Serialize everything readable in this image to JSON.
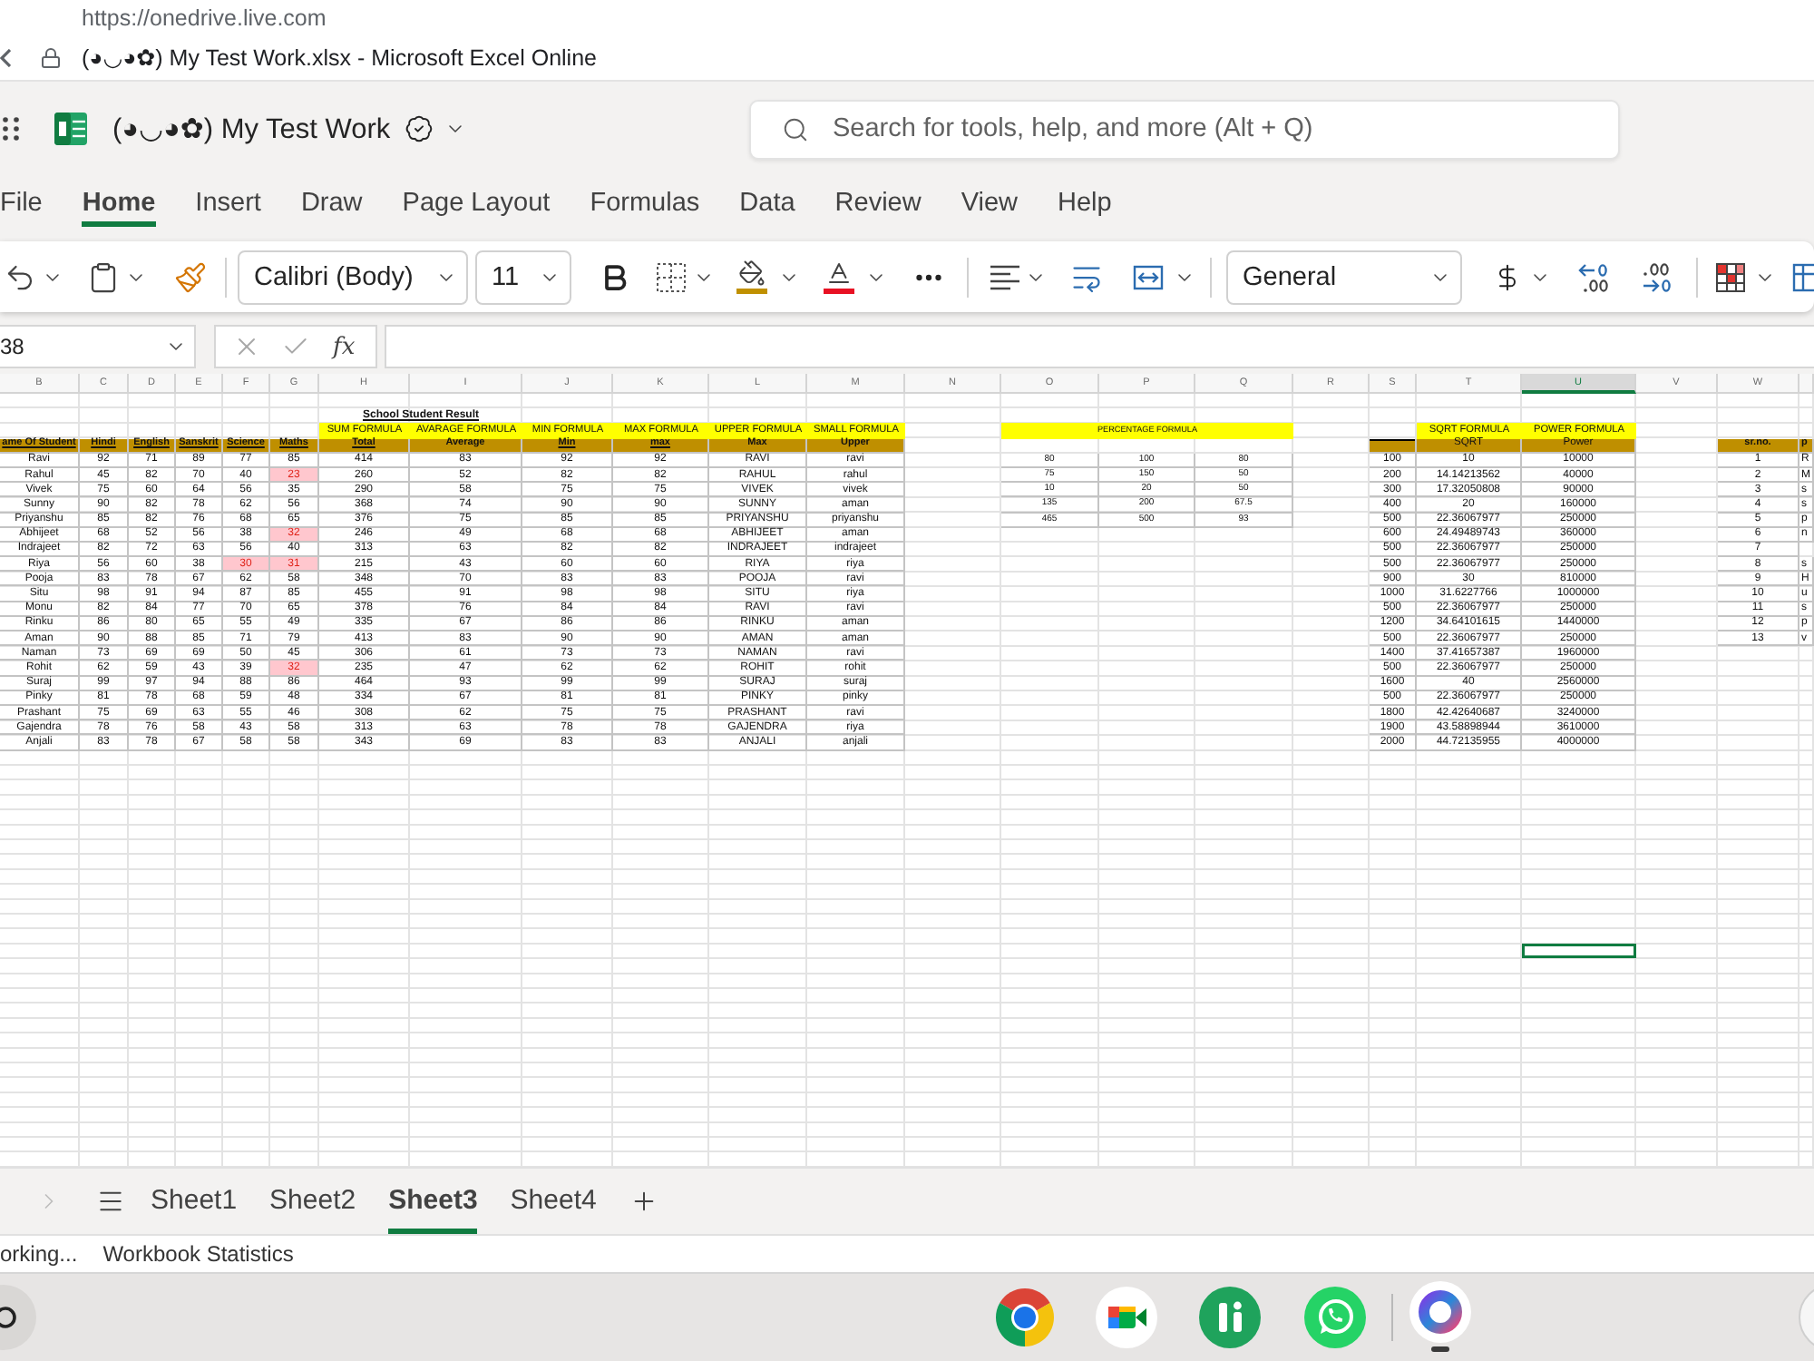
{
  "browser": {
    "url": "https://onedrive.live.com",
    "title": "(◕◡◕✿) My Test Work.xlsx - Microsoft Excel Online"
  },
  "app_bar": {
    "document_title": "(◕◡◕✿) My Test Work",
    "search": {
      "placeholder": "Search for tools, help, and more (Alt + Q)"
    }
  },
  "ribbon_tabs": [
    {
      "label": "File",
      "selected": false
    },
    {
      "label": "Home",
      "selected": true
    },
    {
      "label": "Insert",
      "selected": false
    },
    {
      "label": "Draw",
      "selected": false
    },
    {
      "label": "Page Layout",
      "selected": false
    },
    {
      "label": "Formulas",
      "selected": false
    },
    {
      "label": "Data",
      "selected": false
    },
    {
      "label": "Review",
      "selected": false
    },
    {
      "label": "View",
      "selected": false
    },
    {
      "label": "Help",
      "selected": false
    }
  ],
  "toolbar": {
    "font": "Calibri (Body)",
    "font_size": "11",
    "number_format": "General"
  },
  "formula_bar": {
    "name_box": "38",
    "function_button": "fx"
  },
  "sheet": {
    "columns": [
      {
        "letter": "B",
        "selected": false
      },
      {
        "letter": "C",
        "selected": false
      },
      {
        "letter": "D",
        "selected": false
      },
      {
        "letter": "E",
        "selected": false
      },
      {
        "letter": "F",
        "selected": false
      },
      {
        "letter": "G",
        "selected": false
      },
      {
        "letter": "H",
        "selected": false
      },
      {
        "letter": "I",
        "selected": false
      },
      {
        "letter": "J",
        "selected": false
      },
      {
        "letter": "K",
        "selected": false
      },
      {
        "letter": "L",
        "selected": false
      },
      {
        "letter": "M",
        "selected": false
      },
      {
        "letter": "N",
        "selected": false
      },
      {
        "letter": "O",
        "selected": false
      },
      {
        "letter": "P",
        "selected": false
      },
      {
        "letter": "Q",
        "selected": false
      },
      {
        "letter": "R",
        "selected": false
      },
      {
        "letter": "S",
        "selected": false
      },
      {
        "letter": "T",
        "selected": false
      },
      {
        "letter": "U",
        "selected": true
      },
      {
        "letter": "V",
        "selected": false
      },
      {
        "letter": "W",
        "selected": false
      }
    ],
    "title": "School Student Result",
    "formula_labels": [
      "SUM FORMULA",
      "AVARAGE FORMULA",
      "MIN FORMULA",
      "MAX FORMULA",
      "UPPER FORMULA",
      "SMALL FORMULA"
    ],
    "headers": [
      {
        "text": "ame Of Student",
        "underlined": true
      },
      {
        "text": "Hindi",
        "underlined": true
      },
      {
        "text": "English",
        "underlined": true
      },
      {
        "text": "Sanskrit",
        "underlined": true
      },
      {
        "text": "Science",
        "underlined": true
      },
      {
        "text": "Maths",
        "underlined": true
      },
      {
        "text": "Total",
        "underlined": true
      },
      {
        "text": "Average",
        "underlined": false
      },
      {
        "text": "Min",
        "underlined": true
      },
      {
        "text": "max",
        "underlined": true
      },
      {
        "text": "Max",
        "underlined": false
      },
      {
        "text": "Upper",
        "underlined": false
      }
    ],
    "students": [
      {
        "name": "Ravi",
        "marks": [
          {
            "value": "92",
            "flagged": false
          },
          {
            "value": "71",
            "flagged": false
          },
          {
            "value": "89",
            "flagged": false
          },
          {
            "value": "77",
            "flagged": false
          },
          {
            "value": "85",
            "flagged": false
          }
        ],
        "results": [
          "414",
          "83",
          "92",
          "92",
          "RAVI",
          "ravi"
        ]
      },
      {
        "name": "Rahul",
        "marks": [
          {
            "value": "45",
            "flagged": false
          },
          {
            "value": "82",
            "flagged": false
          },
          {
            "value": "70",
            "flagged": false
          },
          {
            "value": "40",
            "flagged": false
          },
          {
            "value": "23",
            "flagged": true
          }
        ],
        "results": [
          "260",
          "52",
          "82",
          "82",
          "RAHUL",
          "rahul"
        ]
      },
      {
        "name": "Vivek",
        "marks": [
          {
            "value": "75",
            "flagged": false
          },
          {
            "value": "60",
            "flagged": false
          },
          {
            "value": "64",
            "flagged": false
          },
          {
            "value": "56",
            "flagged": false
          },
          {
            "value": "35",
            "flagged": false
          }
        ],
        "results": [
          "290",
          "58",
          "75",
          "75",
          "VIVEK",
          "vivek"
        ]
      },
      {
        "name": "Sunny",
        "marks": [
          {
            "value": "90",
            "flagged": false
          },
          {
            "value": "82",
            "flagged": false
          },
          {
            "value": "78",
            "flagged": false
          },
          {
            "value": "62",
            "flagged": false
          },
          {
            "value": "56",
            "flagged": false
          }
        ],
        "results": [
          "368",
          "74",
          "90",
          "90",
          "SUNNY",
          "aman"
        ]
      },
      {
        "name": "Priyanshu",
        "marks": [
          {
            "value": "85",
            "flagged": false
          },
          {
            "value": "82",
            "flagged": false
          },
          {
            "value": "76",
            "flagged": false
          },
          {
            "value": "68",
            "flagged": false
          },
          {
            "value": "65",
            "flagged": false
          }
        ],
        "results": [
          "376",
          "75",
          "85",
          "85",
          "PRIYANSHU",
          "priyanshu"
        ]
      },
      {
        "name": "Abhijeet",
        "marks": [
          {
            "value": "68",
            "flagged": false
          },
          {
            "value": "52",
            "flagged": false
          },
          {
            "value": "56",
            "flagged": false
          },
          {
            "value": "38",
            "flagged": false
          },
          {
            "value": "32",
            "flagged": true
          }
        ],
        "results": [
          "246",
          "49",
          "68",
          "68",
          "ABHIJEET",
          "aman"
        ]
      },
      {
        "name": "Indrajeet",
        "marks": [
          {
            "value": "82",
            "flagged": false
          },
          {
            "value": "72",
            "flagged": false
          },
          {
            "value": "63",
            "flagged": false
          },
          {
            "value": "56",
            "flagged": false
          },
          {
            "value": "40",
            "flagged": false
          }
        ],
        "results": [
          "313",
          "63",
          "82",
          "82",
          "INDRAJEET",
          "indrajeet"
        ]
      },
      {
        "name": "Riya",
        "marks": [
          {
            "value": "56",
            "flagged": false
          },
          {
            "value": "60",
            "flagged": false
          },
          {
            "value": "38",
            "flagged": false
          },
          {
            "value": "30",
            "flagged": true
          },
          {
            "value": "31",
            "flagged": true
          }
        ],
        "results": [
          "215",
          "43",
          "60",
          "60",
          "RIYA",
          "riya"
        ]
      },
      {
        "name": "Pooja",
        "marks": [
          {
            "value": "83",
            "flagged": false
          },
          {
            "value": "78",
            "flagged": false
          },
          {
            "value": "67",
            "flagged": false
          },
          {
            "value": "62",
            "flagged": false
          },
          {
            "value": "58",
            "flagged": false
          }
        ],
        "results": [
          "348",
          "70",
          "83",
          "83",
          "POOJA",
          "ravi"
        ]
      },
      {
        "name": "Situ",
        "marks": [
          {
            "value": "98",
            "flagged": false
          },
          {
            "value": "91",
            "flagged": false
          },
          {
            "value": "94",
            "flagged": false
          },
          {
            "value": "87",
            "flagged": false
          },
          {
            "value": "85",
            "flagged": false
          }
        ],
        "results": [
          "455",
          "91",
          "98",
          "98",
          "SITU",
          "riya"
        ]
      },
      {
        "name": "Monu",
        "marks": [
          {
            "value": "82",
            "flagged": false
          },
          {
            "value": "84",
            "flagged": false
          },
          {
            "value": "77",
            "flagged": false
          },
          {
            "value": "70",
            "flagged": false
          },
          {
            "value": "65",
            "flagged": false
          }
        ],
        "results": [
          "378",
          "76",
          "84",
          "84",
          "RAVI",
          "ravi"
        ]
      },
      {
        "name": "Rinku",
        "marks": [
          {
            "value": "86",
            "flagged": false
          },
          {
            "value": "80",
            "flagged": false
          },
          {
            "value": "65",
            "flagged": false
          },
          {
            "value": "55",
            "flagged": false
          },
          {
            "value": "49",
            "flagged": false
          }
        ],
        "results": [
          "335",
          "67",
          "86",
          "86",
          "RINKU",
          "aman"
        ]
      },
      {
        "name": "Aman",
        "marks": [
          {
            "value": "90",
            "flagged": false
          },
          {
            "value": "88",
            "flagged": false
          },
          {
            "value": "85",
            "flagged": false
          },
          {
            "value": "71",
            "flagged": false
          },
          {
            "value": "79",
            "flagged": false
          }
        ],
        "results": [
          "413",
          "83",
          "90",
          "90",
          "AMAN",
          "aman"
        ]
      },
      {
        "name": "Naman",
        "marks": [
          {
            "value": "73",
            "flagged": false
          },
          {
            "value": "69",
            "flagged": false
          },
          {
            "value": "69",
            "flagged": false
          },
          {
            "value": "50",
            "flagged": false
          },
          {
            "value": "45",
            "flagged": false
          }
        ],
        "results": [
          "306",
          "61",
          "73",
          "73",
          "NAMAN",
          "ravi"
        ]
      },
      {
        "name": "Rohit",
        "marks": [
          {
            "value": "62",
            "flagged": false
          },
          {
            "value": "59",
            "flagged": false
          },
          {
            "value": "43",
            "flagged": false
          },
          {
            "value": "39",
            "flagged": false
          },
          {
            "value": "32",
            "flagged": true
          }
        ],
        "results": [
          "235",
          "47",
          "62",
          "62",
          "ROHIT",
          "rohit"
        ]
      },
      {
        "name": "Suraj",
        "marks": [
          {
            "value": "99",
            "flagged": false
          },
          {
            "value": "97",
            "flagged": false
          },
          {
            "value": "94",
            "flagged": false
          },
          {
            "value": "88",
            "flagged": false
          },
          {
            "value": "86",
            "flagged": false
          }
        ],
        "results": [
          "464",
          "93",
          "99",
          "99",
          "SURAJ",
          "suraj"
        ]
      },
      {
        "name": "Pinky",
        "marks": [
          {
            "value": "81",
            "flagged": false
          },
          {
            "value": "78",
            "flagged": false
          },
          {
            "value": "68",
            "flagged": false
          },
          {
            "value": "59",
            "flagged": false
          },
          {
            "value": "48",
            "flagged": false
          }
        ],
        "results": [
          "334",
          "67",
          "81",
          "81",
          "PINKY",
          "pinky"
        ]
      },
      {
        "name": "Prashant",
        "marks": [
          {
            "value": "75",
            "flagged": false
          },
          {
            "value": "69",
            "flagged": false
          },
          {
            "value": "63",
            "flagged": false
          },
          {
            "value": "55",
            "flagged": false
          },
          {
            "value": "46",
            "flagged": false
          }
        ],
        "results": [
          "308",
          "62",
          "75",
          "75",
          "PRASHANT",
          "ravi"
        ]
      },
      {
        "name": "Gajendra",
        "marks": [
          {
            "value": "78",
            "flagged": false
          },
          {
            "value": "76",
            "flagged": false
          },
          {
            "value": "58",
            "flagged": false
          },
          {
            "value": "43",
            "flagged": false
          },
          {
            "value": "58",
            "flagged": false
          }
        ],
        "results": [
          "313",
          "63",
          "78",
          "78",
          "GAJENDRA",
          "riya"
        ]
      },
      {
        "name": "Anjali",
        "marks": [
          {
            "value": "83",
            "flagged": false
          },
          {
            "value": "78",
            "flagged": false
          },
          {
            "value": "67",
            "flagged": false
          },
          {
            "value": "58",
            "flagged": false
          },
          {
            "value": "58",
            "flagged": false
          }
        ],
        "results": [
          "343",
          "69",
          "83",
          "83",
          "ANJALI",
          "anjali"
        ]
      }
    ],
    "percentage_table": {
      "title": "PERCENTAGE FORMULA",
      "rows": [
        [
          "80",
          "100",
          "80"
        ],
        [
          "75",
          "150",
          "50"
        ],
        [
          "10",
          "20",
          "50"
        ],
        [
          "135",
          "200",
          "67.5"
        ],
        [
          "465",
          "500",
          "93"
        ]
      ]
    },
    "sqrt_table": {
      "labels": [
        "SQRT FORMULA",
        "POWER FORMULA"
      ],
      "headers": [
        "SQRT",
        "Power"
      ],
      "rows": [
        [
          "100",
          "10",
          "10000"
        ],
        [
          "200",
          "14.14213562",
          "40000"
        ],
        [
          "300",
          "17.32050808",
          "90000"
        ],
        [
          "400",
          "20",
          "160000"
        ],
        [
          "500",
          "22.36067977",
          "250000"
        ],
        [
          "600",
          "24.49489743",
          "360000"
        ],
        [
          "500",
          "22.36067977",
          "250000"
        ],
        [
          "500",
          "22.36067977",
          "250000"
        ],
        [
          "900",
          "30",
          "810000"
        ],
        [
          "1000",
          "31.6227766",
          "1000000"
        ],
        [
          "500",
          "22.36067977",
          "250000"
        ],
        [
          "1200",
          "34.64101615",
          "1440000"
        ],
        [
          "500",
          "22.36067977",
          "250000"
        ],
        [
          "1400",
          "37.41657387",
          "1960000"
        ],
        [
          "500",
          "22.36067977",
          "250000"
        ],
        [
          "1600",
          "40",
          "2560000"
        ],
        [
          "500",
          "22.36067977",
          "250000"
        ],
        [
          "1800",
          "42.42640687",
          "3240000"
        ],
        [
          "1900",
          "43.58898944",
          "3610000"
        ],
        [
          "2000",
          "44.72135955",
          "4000000"
        ]
      ]
    },
    "serial_table": {
      "headers": [
        "sr.no.",
        "p"
      ],
      "rows": [
        [
          "1",
          "R"
        ],
        [
          "2",
          "M"
        ],
        [
          "3",
          "s"
        ],
        [
          "4",
          "s"
        ],
        [
          "5",
          "p"
        ],
        [
          "6",
          "n"
        ],
        [
          "7"
        ],
        [
          "8",
          "s"
        ],
        [
          "9",
          "H"
        ],
        [
          "10",
          "u"
        ],
        [
          "11",
          "s"
        ],
        [
          "12",
          "p"
        ],
        [
          "13",
          "v"
        ]
      ]
    },
    "blank_rows": [
      {
        "selected": false
      },
      {
        "selected": false
      },
      {
        "selected": false
      },
      {
        "selected": false
      },
      {
        "selected": false
      },
      {
        "selected": false
      },
      {
        "selected": false
      },
      {
        "selected": false
      },
      {
        "selected": false
      },
      {
        "selected": false
      },
      {
        "selected": false
      },
      {
        "selected": false
      },
      {
        "selected": false
      },
      {
        "selected": true
      },
      {
        "selected": false
      },
      {
        "selected": false
      },
      {
        "selected": false
      },
      {
        "selected": false
      },
      {
        "selected": false
      },
      {
        "selected": false
      },
      {
        "selected": false
      },
      {
        "selected": false
      },
      {
        "selected": false
      },
      {
        "selected": false
      },
      {
        "selected": false
      },
      {
        "selected": false
      },
      {
        "selected": false
      },
      {
        "selected": false
      }
    ]
  },
  "sheet_tabs": [
    {
      "label": "Sheet1",
      "selected": false
    },
    {
      "label": "Sheet2",
      "selected": false
    },
    {
      "label": "Sheet3",
      "selected": true
    },
    {
      "label": "Sheet4",
      "selected": false
    }
  ],
  "status_bar": {
    "status": "orking...",
    "statistics_button": "Workbook Statistics"
  }
}
